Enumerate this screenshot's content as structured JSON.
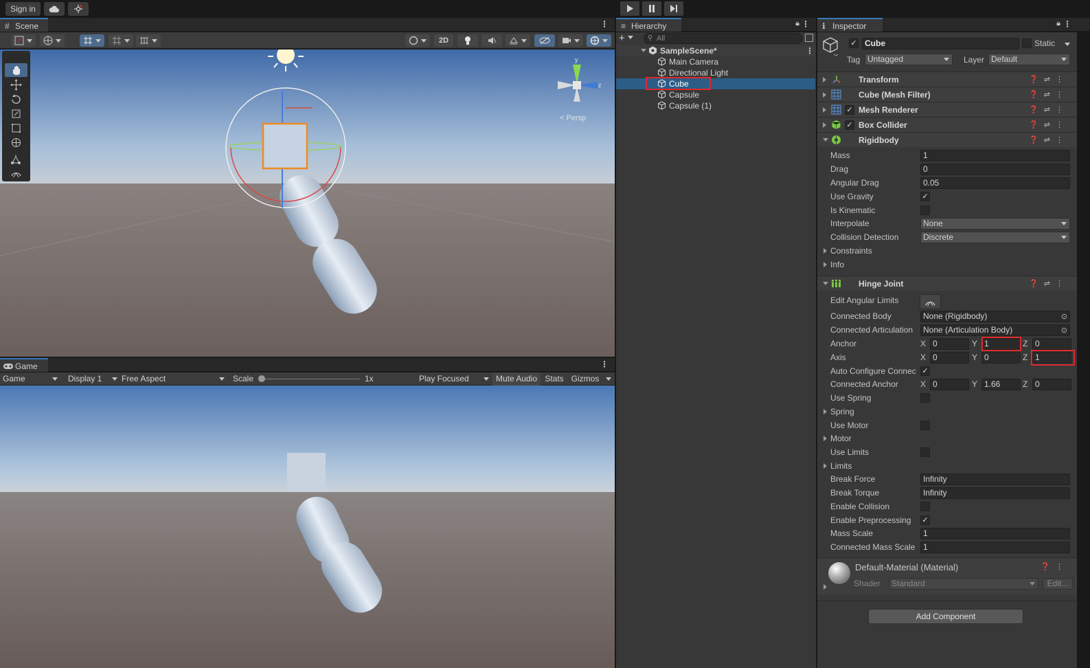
{
  "topbar": {
    "sign_in": "Sign in"
  },
  "scene": {
    "tab": "Scene",
    "toolbar": {
      "mode_2d": "2D"
    },
    "persp_label": "< Persp",
    "gizmo_axes": {
      "y": "y",
      "z": "z"
    }
  },
  "game": {
    "tab": "Game",
    "toolbar": {
      "view": "Game",
      "display": "Display 1",
      "aspect": "Free Aspect",
      "scale_label": "Scale",
      "scale_value": "1x",
      "play_mode": "Play Focused",
      "mute": "Mute Audio",
      "stats": "Stats",
      "gizmos": "Gizmos"
    }
  },
  "hierarchy": {
    "tab": "Hierarchy",
    "search_placeholder": "All",
    "scene_name": "SampleScene*",
    "items": [
      "Main Camera",
      "Directional Light",
      "Cube",
      "Capsule",
      "Capsule (1)"
    ],
    "selected": "Cube"
  },
  "inspector": {
    "tab": "Inspector",
    "object_name": "Cube",
    "static_label": "Static",
    "tag_label": "Tag",
    "tag_value": "Untagged",
    "layer_label": "Layer",
    "layer_value": "Default",
    "components": {
      "transform": "Transform",
      "mesh_filter": "Cube (Mesh Filter)",
      "mesh_renderer": "Mesh Renderer",
      "box_collider": "Box Collider",
      "rigidbody": "Rigidbody",
      "hinge_joint": "Hinge Joint"
    },
    "rigidbody": {
      "mass_label": "Mass",
      "mass": "1",
      "drag_label": "Drag",
      "drag": "0",
      "angular_drag_label": "Angular Drag",
      "angular_drag": "0.05",
      "use_gravity_label": "Use Gravity",
      "use_gravity": true,
      "is_kinematic_label": "Is Kinematic",
      "is_kinematic": false,
      "interpolate_label": "Interpolate",
      "interpolate": "None",
      "collision_label": "Collision Detection",
      "collision": "Discrete",
      "constraints_label": "Constraints",
      "info_label": "Info"
    },
    "hinge": {
      "edit_limits_label": "Edit Angular Limits",
      "connected_body_label": "Connected Body",
      "connected_body": "None (Rigidbody)",
      "connected_art_label": "Connected Articulation",
      "connected_art": "None (Articulation Body)",
      "anchor_label": "Anchor",
      "anchor": {
        "x": "0",
        "y": "1",
        "z": "0"
      },
      "axis_label": "Axis",
      "axis": {
        "x": "0",
        "y": "0",
        "z": "1"
      },
      "auto_config_label": "Auto Configure Connec",
      "connected_anchor_label": "Connected Anchor",
      "connected_anchor": {
        "x": "0",
        "y": "1.66",
        "z": "0"
      },
      "use_spring_label": "Use Spring",
      "spring_label": "Spring",
      "use_motor_label": "Use Motor",
      "motor_label": "Motor",
      "use_limits_label": "Use Limits",
      "limits_label": "Limits",
      "break_force_label": "Break Force",
      "break_force": "Infinity",
      "break_torque_label": "Break Torque",
      "break_torque": "Infinity",
      "enable_collision_label": "Enable Collision",
      "enable_pre_label": "Enable Preprocessing",
      "mass_scale_label": "Mass Scale",
      "mass_scale": "1",
      "conn_mass_scale_label": "Connected Mass Scale",
      "conn_mass_scale": "1"
    },
    "material": {
      "name": "Default-Material (Material)",
      "shader_label": "Shader",
      "shader": "Standard",
      "edit": "Edit..."
    },
    "add_component": "Add Component",
    "axis_letters": {
      "x": "X",
      "y": "Y",
      "z": "Z"
    }
  },
  "colors": {
    "selection": "#2c5d87",
    "highlight": "#e0282a",
    "accent": "#3a79bb"
  }
}
